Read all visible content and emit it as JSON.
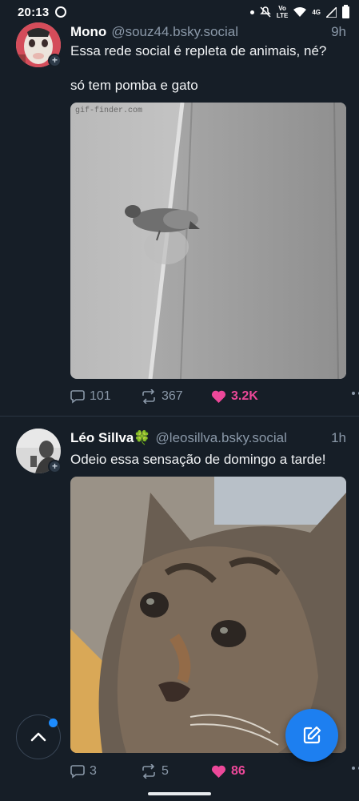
{
  "status_bar": {
    "time": "20:13",
    "network_labels": [
      "Vo",
      "LTE"
    ],
    "network_type": "4G"
  },
  "posts": [
    {
      "display_name": "Mono",
      "handle": "@souz44.bsky.social",
      "time_ago": "9h",
      "text_lines": [
        "Essa rede social é repleta de animais, né?",
        "só tem pomba e gato"
      ],
      "media_caption": "gif-finder.com",
      "replies": "101",
      "reposts": "367",
      "likes": "3.2K"
    },
    {
      "display_name": "Léo Sillva🍀",
      "handle": "@leosillva.bsky.social",
      "time_ago": "1h",
      "text_lines": [
        "Odeio essa sensação de domingo a tarde!"
      ],
      "replies": "3",
      "reposts": "5",
      "likes": "86"
    }
  ],
  "icons": {
    "reply": "chat-bubble-icon",
    "repost": "repost-arrows-icon",
    "like": "heart-icon",
    "more": "more-dots-icon",
    "scroll_top": "chevron-up-icon",
    "compose": "compose-pencil-icon"
  },
  "colors": {
    "background": "#161e27",
    "like_active": "#ec4899",
    "accent": "#1d7ff0"
  }
}
